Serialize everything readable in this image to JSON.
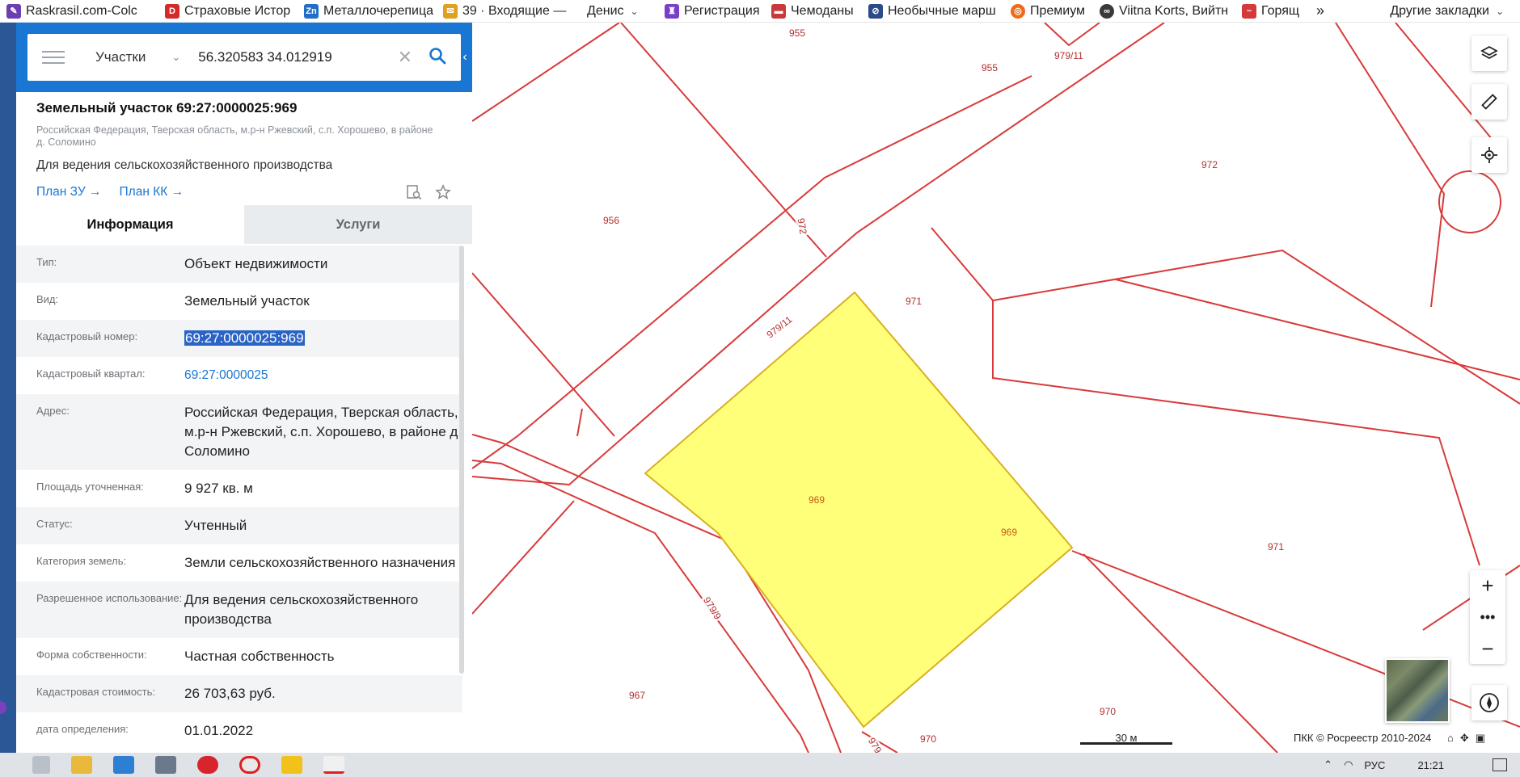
{
  "bookmarks": [
    {
      "label": "Raskrasil.com-Colc",
      "icon": "raskrasil-icon",
      "color": "#6a3fb0"
    },
    {
      "label": "Страховые Истор",
      "icon": "d-logo-icon",
      "color": "#d42a2a",
      "glyph": "D"
    },
    {
      "label": "Металлочерепица",
      "icon": "zn-logo-icon",
      "color": "#1f6fc9",
      "glyph": "Zn"
    },
    {
      "label": "39 · Входящие — ",
      "icon": "mail-icon",
      "color": "#e0a020"
    },
    {
      "label": "Денис",
      "icon": "folder-icon",
      "color": "#ffffff",
      "dropdown": true
    },
    {
      "label": "Регистрация",
      "icon": "registration-icon",
      "color": "#7a3fc8"
    },
    {
      "label": "Чемоданы",
      "icon": "suitcase-icon",
      "color": "#c83a3a"
    },
    {
      "label": "Необычные марш",
      "icon": "compass-icon",
      "color": "#2c4a8a"
    },
    {
      "label": "Премиум",
      "icon": "premium-icon",
      "color": "#ef6b1a"
    },
    {
      "label": "Viitna Korts, Вийтн",
      "icon": "tripadvisor-icon",
      "color": "#3a3a3a"
    },
    {
      "label": "Горящ",
      "icon": "hot-tours-icon",
      "color": "#d43a3a"
    }
  ],
  "bookmarks_more": "»",
  "bookmarks_other": "Другие закладки",
  "search": {
    "type_label": "Участки",
    "value": "56.320583 34.012919"
  },
  "object": {
    "title": "Земельный участок 69:27:0000025:969",
    "address_short": "Российская Федерация, Тверская область, м.р-н Ржевский, с.п. Хорошево, в районе д. Соломино",
    "purpose": "Для ведения сельскохозяйственного производства",
    "plan_zu": "План ЗУ",
    "plan_kk": "План КК"
  },
  "tabs": {
    "info": "Информация",
    "services": "Услуги"
  },
  "info_rows": [
    {
      "key": "Тип:",
      "value": "Объект недвижимости"
    },
    {
      "key": "Вид:",
      "value": "Земельный участок"
    },
    {
      "key": "Кадастровый номер:",
      "value": "69:27:0000025:969"
    },
    {
      "key": "Кадастровый квартал:",
      "value": "69:27:0000025"
    },
    {
      "key": "Адрес:",
      "value": "Российская Федерация, Тверская область, м.р-н Ржевский, с.п. Хорошево, в районе д. Соломино"
    },
    {
      "key": "Площадь уточненная:",
      "value": "9 927 кв. м"
    },
    {
      "key": "Статус:",
      "value": "Учтенный"
    },
    {
      "key": "Категория земель:",
      "value": "Земли сельскохозяйственного назначения"
    },
    {
      "key": "Разрешенное использование:",
      "value": "Для ведения сельскохозяйственного производства"
    },
    {
      "key": "Форма собственности:",
      "value": "Частная собственность"
    },
    {
      "key": "Кадастровая стоимость:",
      "value": "26 703,63 руб."
    },
    {
      "key": "дата определения:",
      "value": "01.01.2022"
    }
  ],
  "map_labels": {
    "l955a": "955",
    "l955b": "955",
    "l979_11a": "979/11",
    "l972a": "972",
    "l956": "956",
    "l972b": "972",
    "l971a": "971",
    "l979_11b": "979/11",
    "l969a": "969",
    "l969b": "969",
    "l971b": "971",
    "l979_9": "979/9",
    "l967": "967",
    "l970a": "970",
    "l970b": "970",
    "l979": "979"
  },
  "scale_label": "30 м",
  "copyright": "ПКК © Росреестр 2010-2024",
  "clock": "21:21",
  "lang": "РУС",
  "colors": {
    "accent": "#1976d2",
    "parcel_fill": "#ffff7a",
    "parcel_line": "#d83a3a"
  }
}
